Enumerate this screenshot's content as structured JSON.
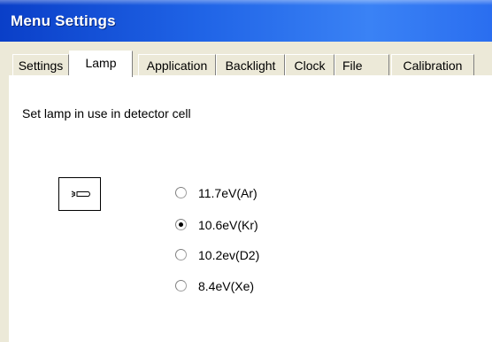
{
  "window": {
    "title": "Menu Settings"
  },
  "tabs": [
    {
      "label": "Settings",
      "active": false
    },
    {
      "label": "Lamp",
      "active": true
    },
    {
      "label": "Application",
      "active": false
    },
    {
      "label": "Backlight",
      "active": false
    },
    {
      "label": "Clock",
      "active": false
    },
    {
      "label": "File",
      "active": false
    },
    {
      "label": "Calibration",
      "active": false
    }
  ],
  "lamp_panel": {
    "description": "Set lamp in use in detector cell",
    "lamp_icon": "lamp-icon",
    "options": [
      {
        "label": "11.7eV(Ar)",
        "selected": false
      },
      {
        "label": "10.6eV(Kr)",
        "selected": true
      },
      {
        "label": "10.2ev(D2)",
        "selected": false
      },
      {
        "label": "8.4eV(Xe)",
        "selected": false
      }
    ]
  },
  "colors": {
    "title_bar": "#1f63e6",
    "window_bg": "#ece9d8",
    "panel_bg": "#ffffff"
  }
}
